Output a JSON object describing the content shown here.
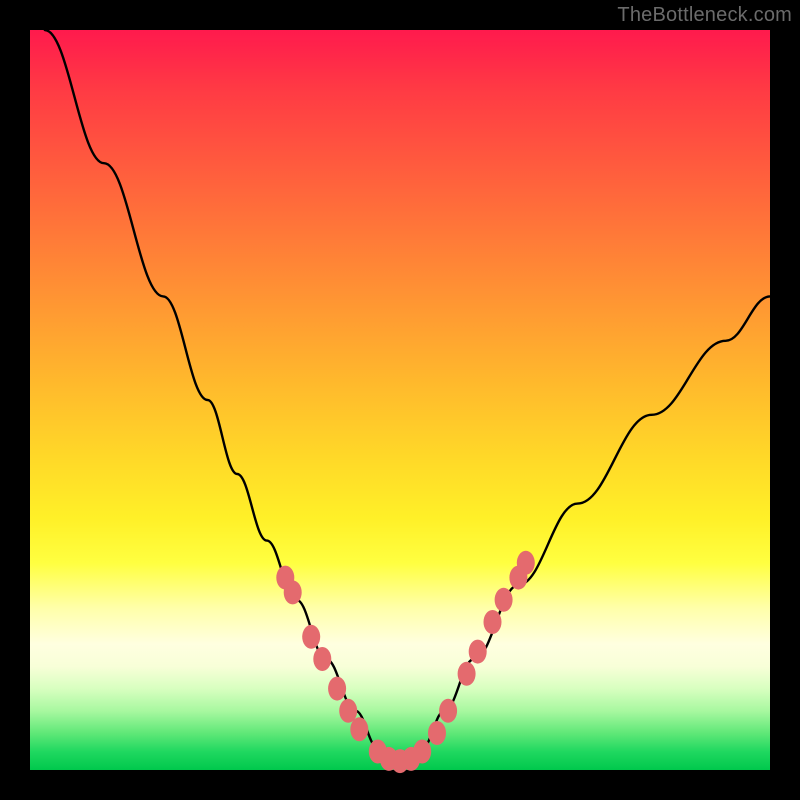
{
  "attribution": "TheBottleneck.com",
  "chart_data": {
    "type": "line",
    "title": "",
    "xlabel": "",
    "ylabel": "",
    "xlim": [
      0,
      100
    ],
    "ylim": [
      0,
      100
    ],
    "series": [
      {
        "name": "bottleneck-curve",
        "x": [
          2,
          10,
          18,
          24,
          28,
          32,
          36,
          40,
          44,
          47,
          50,
          53,
          56,
          60,
          66,
          74,
          84,
          94,
          100
        ],
        "y": [
          100,
          82,
          64,
          50,
          40,
          31,
          23,
          15,
          8,
          3,
          0,
          3,
          8,
          15,
          25,
          36,
          48,
          58,
          64
        ]
      }
    ],
    "markers": {
      "name": "highlighted-points",
      "color": "#e46a6e",
      "points": [
        {
          "x": 34.5,
          "y": 26
        },
        {
          "x": 35.5,
          "y": 24
        },
        {
          "x": 38,
          "y": 18
        },
        {
          "x": 39.5,
          "y": 15
        },
        {
          "x": 41.5,
          "y": 11
        },
        {
          "x": 43,
          "y": 8
        },
        {
          "x": 44.5,
          "y": 5.5
        },
        {
          "x": 47,
          "y": 2.5
        },
        {
          "x": 48.5,
          "y": 1.5
        },
        {
          "x": 50,
          "y": 1.2
        },
        {
          "x": 51.5,
          "y": 1.5
        },
        {
          "x": 53,
          "y": 2.5
        },
        {
          "x": 55,
          "y": 5
        },
        {
          "x": 56.5,
          "y": 8
        },
        {
          "x": 59,
          "y": 13
        },
        {
          "x": 60.5,
          "y": 16
        },
        {
          "x": 62.5,
          "y": 20
        },
        {
          "x": 64,
          "y": 23
        },
        {
          "x": 66,
          "y": 26
        },
        {
          "x": 67,
          "y": 28
        }
      ]
    }
  }
}
